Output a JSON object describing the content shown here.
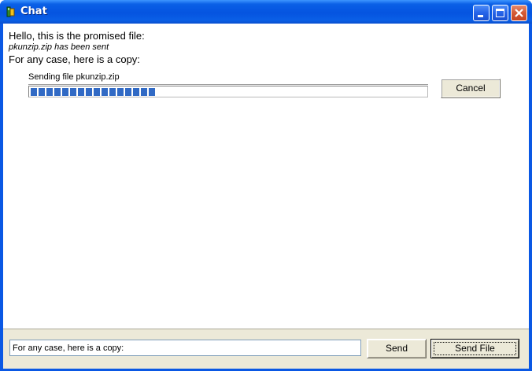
{
  "window": {
    "title": "Chat",
    "icon": "app-icon",
    "controls": [
      "minimize-icon",
      "maximize-icon",
      "close-icon"
    ]
  },
  "chat": {
    "messages": [
      {
        "text": "Hello, this is the promised file:",
        "style": "normal"
      },
      {
        "text": "pkunzip.zip has been sent",
        "style": "italic"
      },
      {
        "text": "For any case, here is a copy:",
        "style": "normal"
      }
    ]
  },
  "transfer": {
    "label": "Sending file pkunzip.zip",
    "progress_segments_filled": 16,
    "progress_fraction": 0.32,
    "cancel_label": "Cancel",
    "progress_color": "#316ac5"
  },
  "compose": {
    "input_value": "For any case, here is a copy:",
    "send_label": "Send",
    "send_file_label": "Send File"
  }
}
